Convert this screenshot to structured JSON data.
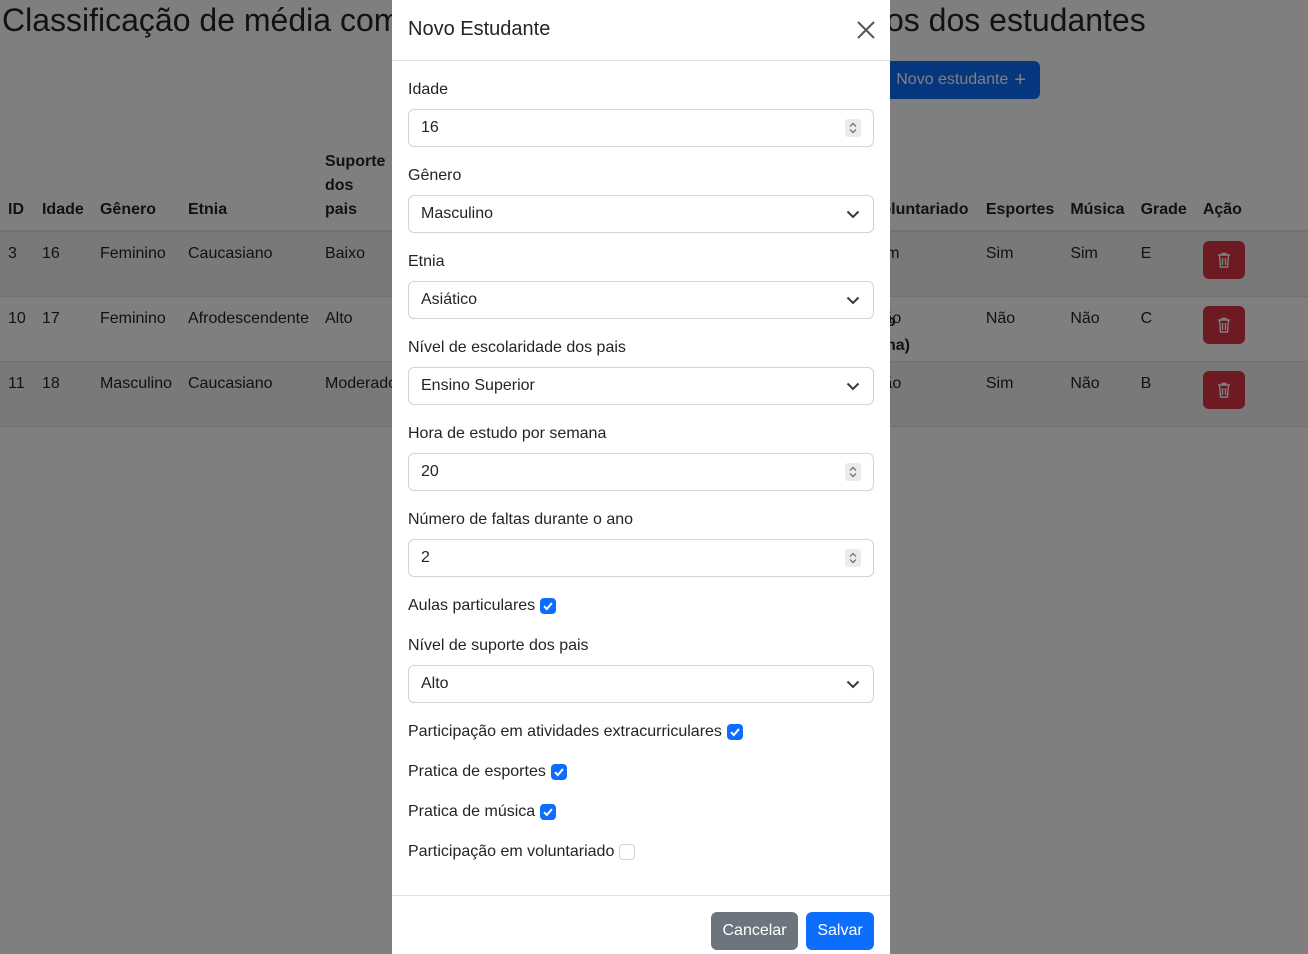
{
  "page": {
    "title": "Classificação de média com base em fatores externos e internos dos estudantes",
    "new_student_label": "Novo estudante",
    "plus_glyph": "+"
  },
  "table": {
    "headers": [
      "ID",
      "Idade",
      "Gênero",
      "Etnia",
      "Suporte dos pais",
      "Voluntariado",
      "Esportes",
      "Música",
      "Grade",
      "Ação"
    ],
    "partial_header_top": "o",
    "partial_header_bottom": "na)",
    "rows": [
      {
        "id": "3",
        "idade": "16",
        "genero": "Feminino",
        "etnia": "Caucasiano",
        "suporte": "Baixo",
        "voluntariado": "Sim",
        "esportes": "Sim",
        "musica": "Sim",
        "grade": "E"
      },
      {
        "id": "10",
        "idade": "17",
        "genero": "Feminino",
        "etnia": "Afrodescendente",
        "suporte": "Alto",
        "voluntariado": "Não",
        "esportes": "Não",
        "musica": "Não",
        "grade": "C"
      },
      {
        "id": "11",
        "idade": "18",
        "genero": "Masculino",
        "etnia": "Caucasiano",
        "suporte": "Moderado",
        "voluntariado": "Não",
        "esportes": "Sim",
        "musica": "Não",
        "grade": "B"
      }
    ],
    "delete_color": "#dc3545"
  },
  "modal": {
    "title": "Novo Estudante",
    "idade": {
      "label": "Idade",
      "value": "16"
    },
    "genero": {
      "label": "Gênero",
      "value": "Masculino"
    },
    "etnia": {
      "label": "Etnia",
      "value": "Asiático"
    },
    "escolaridade": {
      "label": "Nível de escolaridade dos pais",
      "value": "Ensino Superior"
    },
    "horas": {
      "label": "Hora de estudo por semana",
      "value": "20"
    },
    "faltas": {
      "label": "Número de faltas durante o ano",
      "value": "2"
    },
    "aulas_particulares": {
      "label": "Aulas particulares",
      "checked": true
    },
    "suporte": {
      "label": "Nível de suporte dos pais",
      "value": "Alto"
    },
    "extracurriculares": {
      "label": "Participação em atividades extracurriculares",
      "checked": true
    },
    "esportes": {
      "label": "Pratica de esportes",
      "checked": true
    },
    "musica": {
      "label": "Pratica de música",
      "checked": true
    },
    "voluntariado": {
      "label": "Participação em voluntariado",
      "checked": false
    },
    "cancel_label": "Cancelar",
    "save_label": "Salvar"
  },
  "colors": {
    "primary": "#0d6efd",
    "secondary": "#6c757d",
    "danger": "#dc3545",
    "backdrop": "rgba(0,0,0,0.5)"
  },
  "icons": [
    "plus-icon",
    "trash-icon",
    "close-icon",
    "chevron-down-icon",
    "spinner-icon",
    "check-icon"
  ]
}
